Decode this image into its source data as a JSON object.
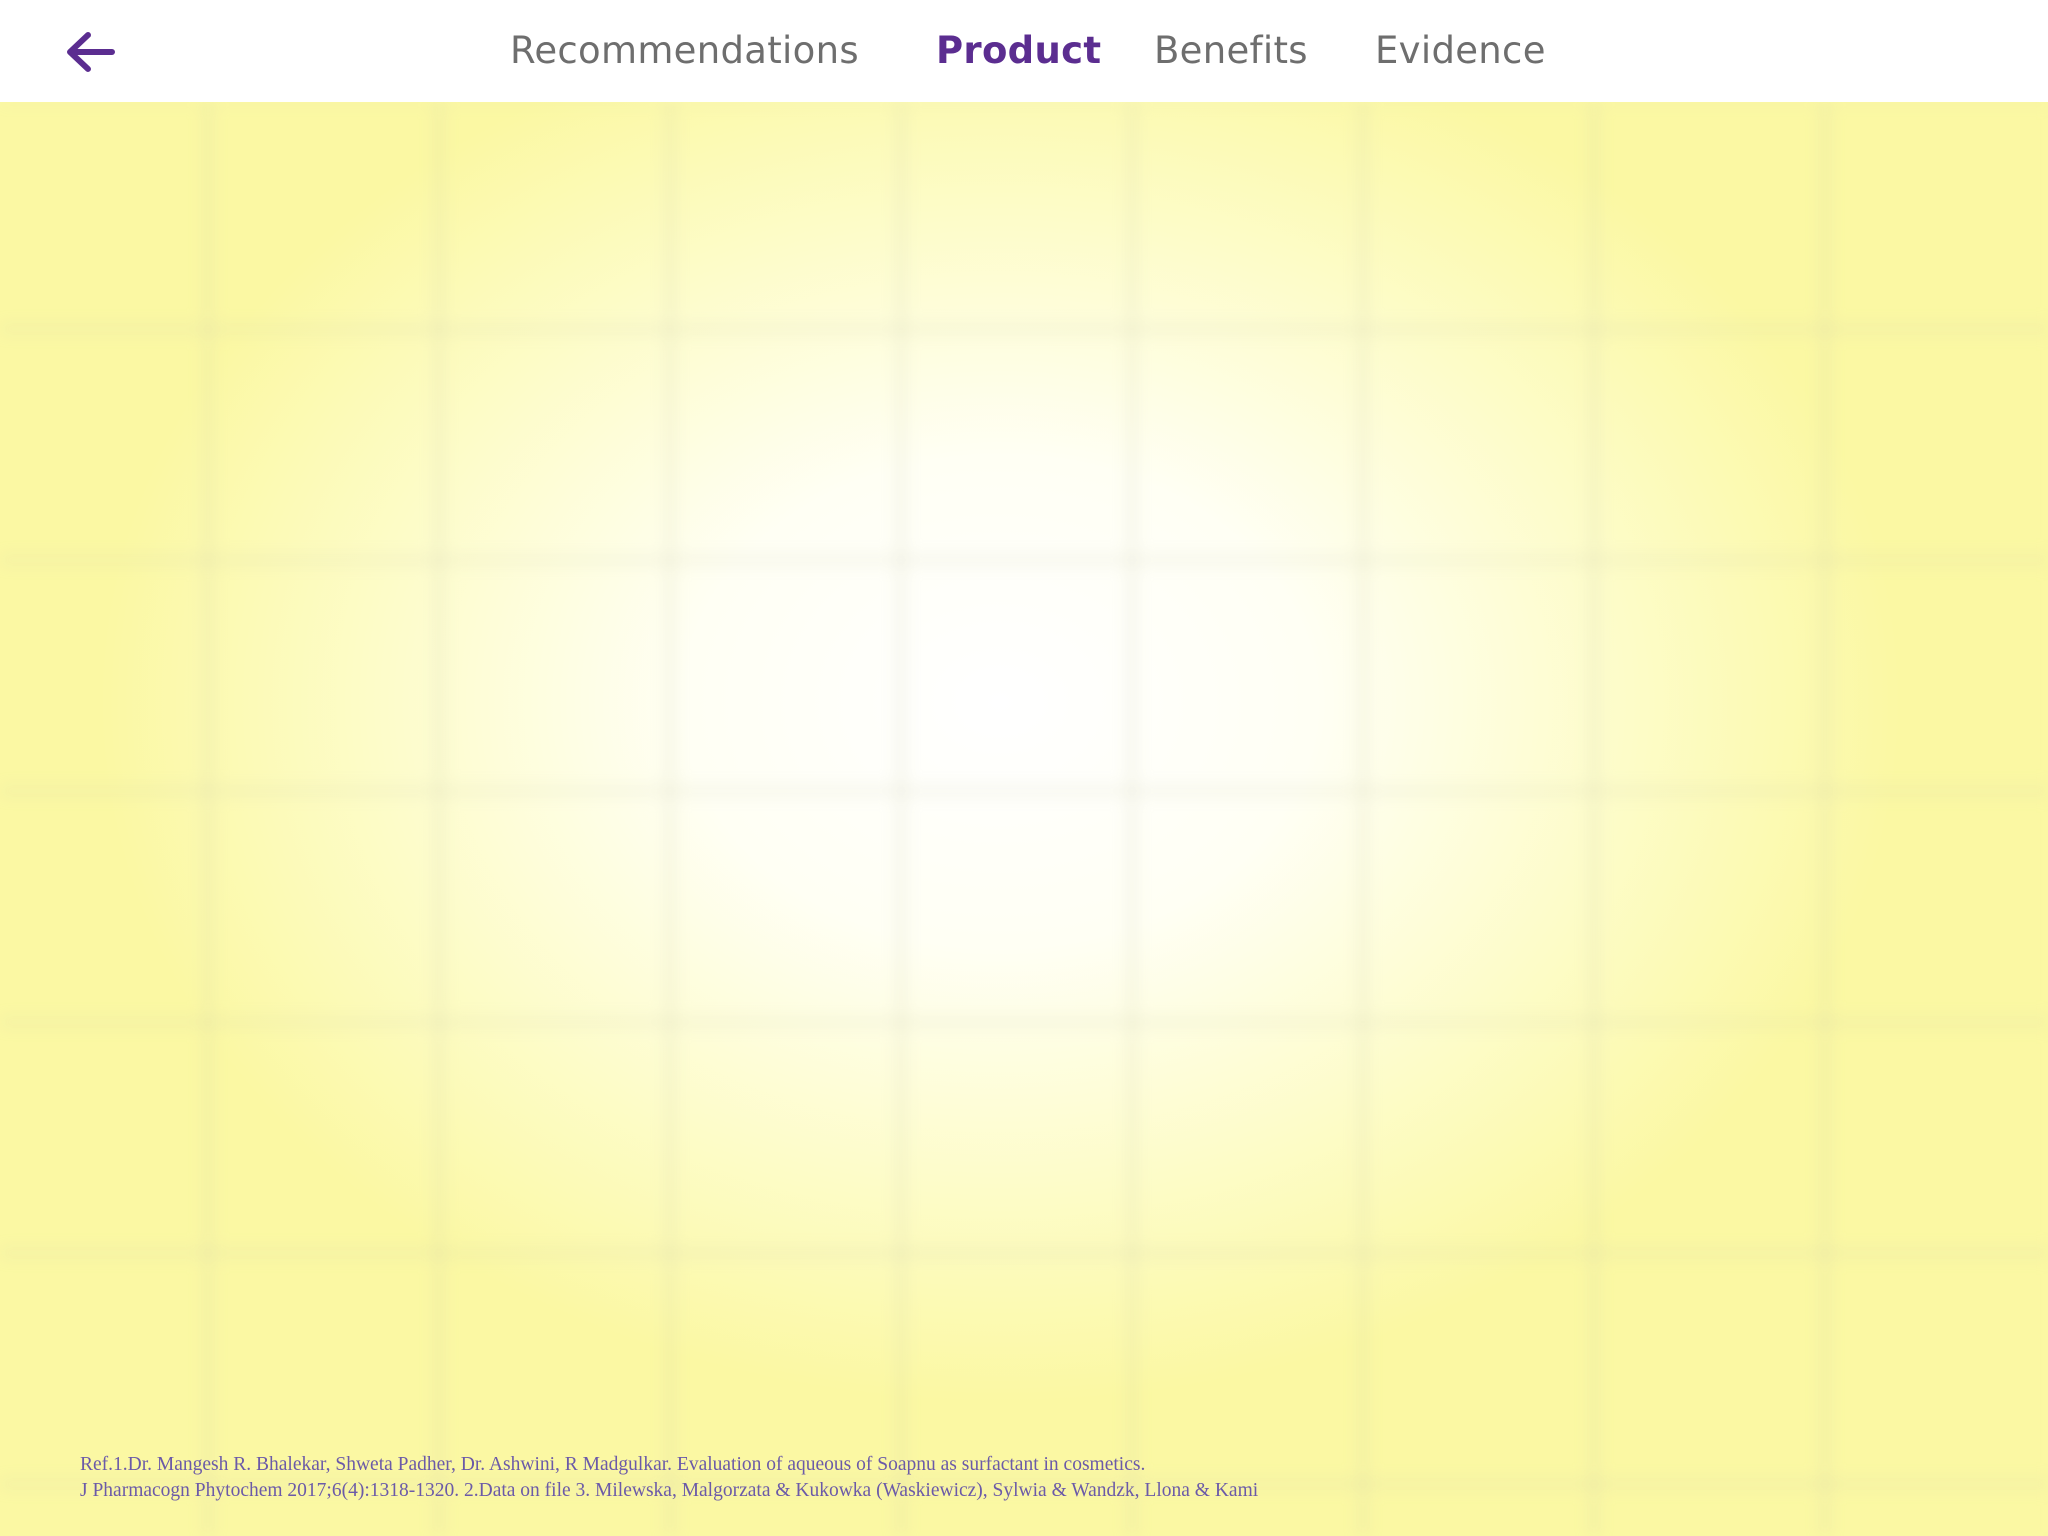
{
  "header": {
    "back_icon": "arrow-left-icon",
    "tabs": [
      {
        "label": "Recommendations",
        "active": false
      },
      {
        "label": "Product",
        "active": true
      },
      {
        "label": "Benefits",
        "active": false
      },
      {
        "label": "Evidence",
        "active": false
      }
    ]
  },
  "footer": {
    "reference_line_1": "Ref.1.Dr. Mangesh R. Bhalekar, Shweta Padher, Dr. Ashwini, R Madgulkar. Evaluation of aqueous of Soapnu as surfactant in cosmetics.",
    "reference_line_2": "J Pharmacogn Phytochem 2017;6(4):1318-1320. 2.Data on file 3. Milewska, Malgorzata & Kukowka (Waskiewicz), Sylwia & Wandzk, Llona & Kami"
  },
  "colors": {
    "accent": "#5b2d90",
    "inactive_tab": "#6e6e6e",
    "reference_text": "#6b5aa8",
    "background_yellow": "#fbf8a3"
  }
}
